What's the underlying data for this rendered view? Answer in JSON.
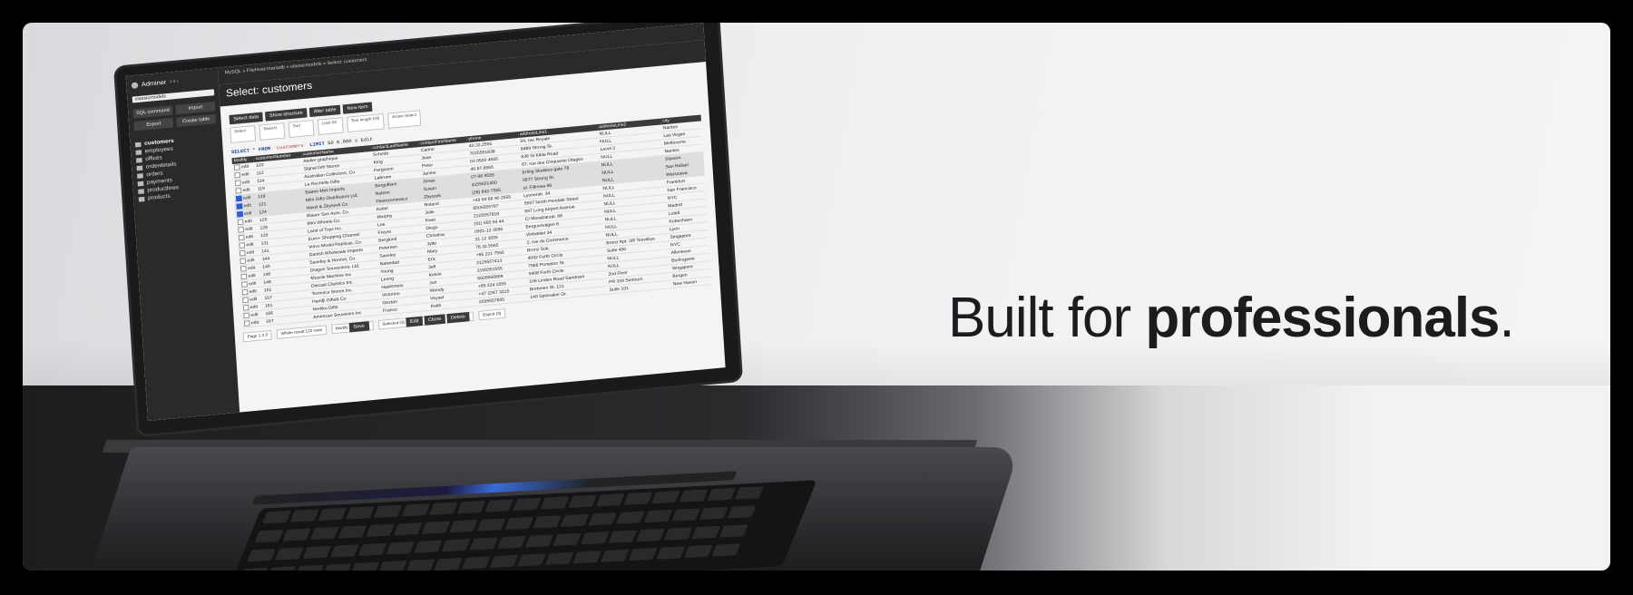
{
  "headline": {
    "light": "Built for ",
    "bold": "professionals",
    "dot": "."
  },
  "app": {
    "name": "Adminer",
    "version": "4.8.1",
    "database": "classicmodels",
    "breadcrumb": "MySQL » FileHost-mariadb » classicmodels » Select: customers",
    "page_title": "Select: customers",
    "side_buttons": [
      "SQL command",
      "Import",
      "Export",
      "Create table"
    ],
    "tables": [
      "customers",
      "employees",
      "offices",
      "orderdetails",
      "orders",
      "payments",
      "productlines",
      "products"
    ],
    "action_buttons": [
      "Select data",
      "Show structure",
      "Alter table",
      "New item"
    ],
    "options": [
      {
        "label": "Select",
        "value": ""
      },
      {
        "label": "Search",
        "value": ""
      },
      {
        "label": "Sort",
        "value": ""
      },
      {
        "label": "Limit",
        "value": "50"
      },
      {
        "label": "Text length",
        "value": "100"
      },
      {
        "label": "Action",
        "value": "Select"
      }
    ],
    "query": {
      "select": "SELECT",
      "star": "*",
      "from": "FROM",
      "table": "`customers`",
      "limit": "LIMIT",
      "n": "50",
      "tail": "0.000 s Edit"
    },
    "columns": [
      "Modify",
      "customerNumber",
      "customerName",
      "contactLastName",
      "contactFirstName",
      "phone",
      "addressLine1",
      "addressLine2",
      "city"
    ],
    "rows": [
      {
        "checked": false,
        "edit": "edit",
        "num": "103",
        "name": "Atelier graphique",
        "last": "Schmitt",
        "first": "Carine",
        "phone": "40.32.2555",
        "addr1": "54, rue Royale",
        "addr2": "NULL",
        "city": "Nantes"
      },
      {
        "checked": false,
        "edit": "edit",
        "num": "112",
        "name": "Signal Gift Stores",
        "last": "King",
        "first": "Jean",
        "phone": "7025551838",
        "addr1": "8489 Strong St.",
        "addr2": "NULL",
        "city": "Las Vegas"
      },
      {
        "checked": false,
        "edit": "edit",
        "num": "114",
        "name": "Australian Collectors, Co.",
        "last": "Ferguson",
        "first": "Peter",
        "phone": "03 9520 4555",
        "addr1": "636 St Kilda Road",
        "addr2": "Level 3",
        "city": "Melbourne"
      },
      {
        "checked": false,
        "edit": "edit",
        "num": "119",
        "name": "La Rochelle Gifts",
        "last": "Labrune",
        "first": "Janine",
        "phone": "40.67.8555",
        "addr1": "67, rue des Cinquante Otages",
        "addr2": "NULL",
        "city": "Nantes"
      },
      {
        "checked": true,
        "edit": "edit",
        "num": "119",
        "name": "Baane Mini Imports",
        "last": "Bergulfsen",
        "first": "Jonas",
        "phone": "07-98 9555",
        "addr1": "Erling Skakkes gate 78",
        "addr2": "NULL",
        "city": "Stavern"
      },
      {
        "checked": true,
        "edit": "edit",
        "num": "121",
        "name": "Mini Gifts Distributors Ltd.",
        "last": "Nelson",
        "first": "Susan",
        "phone": "4155551450",
        "addr1": "5677 Strong St.",
        "addr2": "NULL",
        "city": "San Rafael"
      },
      {
        "checked": true,
        "edit": "edit",
        "num": "124",
        "name": "Havel & Zbyszek Co",
        "last": "Piestrzeniewicz",
        "first": "Zbyszek",
        "phone": "(26) 642-7555",
        "addr1": "ul. Filtrowa 68",
        "addr2": "NULL",
        "city": "Warszawa"
      },
      {
        "checked": false,
        "edit": "edit",
        "num": "125",
        "name": "Blauer See Auto, Co.",
        "last": "Keitel",
        "first": "Roland",
        "phone": "+49 69 66 90 2555",
        "addr1": "Lyonerstr. 34",
        "addr2": "NULL",
        "city": "Frankfurt"
      },
      {
        "checked": false,
        "edit": "edit",
        "num": "128",
        "name": "Mini Wheels Co.",
        "last": "Murphy",
        "first": "Julie",
        "phone": "6505555787",
        "addr1": "5557 North Pendale Street",
        "addr2": "NULL",
        "city": "San Francisco"
      },
      {
        "checked": false,
        "edit": "edit",
        "num": "129",
        "name": "Land of Toys Inc.",
        "last": "Lee",
        "first": "Kwai",
        "phone": "2125557818",
        "addr1": "897 Long Airport Avenue",
        "addr2": "NULL",
        "city": "NYC"
      },
      {
        "checked": false,
        "edit": "edit",
        "num": "131",
        "name": "Euro+ Shopping Channel",
        "last": "Freyre",
        "first": "Diego",
        "phone": "(91) 555 94 44",
        "addr1": "C/ Moralzarzal, 86",
        "addr2": "NULL",
        "city": "Madrid"
      },
      {
        "checked": false,
        "edit": "edit",
        "num": "141",
        "name": "Volvo Model Replicas, Co",
        "last": "Berglund",
        "first": "Christina",
        "phone": "0921-12 3555",
        "addr1": "Berguvsvägen 8",
        "addr2": "NULL",
        "city": "Luleå"
      },
      {
        "checked": false,
        "edit": "edit",
        "num": "144",
        "name": "Danish Wholesale Imports",
        "last": "Petersen",
        "first": "Jytte",
        "phone": "31 12 3555",
        "addr1": "Vinbæltet 34",
        "addr2": "NULL",
        "city": "Kobenhavn"
      },
      {
        "checked": false,
        "edit": "edit",
        "num": "145",
        "name": "Saveley & Henriot, Co.",
        "last": "Saveley",
        "first": "Mary",
        "phone": "78.32.5555",
        "addr1": "2, rue du Commerce",
        "addr2": "NULL",
        "city": "Lyon"
      },
      {
        "checked": false,
        "edit": "edit",
        "num": "146",
        "name": "Dragon Souveniers, Ltd.",
        "last": "Natividad",
        "first": "Eric",
        "phone": "+65 221 7555",
        "addr1": "Bronz Sok.",
        "addr2": "Bronz Apt. 3/6 Tesvikiye",
        "city": "Singapore"
      },
      {
        "checked": false,
        "edit": "edit",
        "num": "148",
        "name": "Muscle Machine Inc",
        "last": "Young",
        "first": "Jeff",
        "phone": "2125557413",
        "addr1": "4092 Furth Circle",
        "addr2": "Suite 400",
        "city": "NYC"
      },
      {
        "checked": false,
        "edit": "edit",
        "num": "151",
        "name": "Diecast Classics Inc.",
        "last": "Leong",
        "first": "Kelvin",
        "phone": "2155551555",
        "addr1": "7586 Pompton St.",
        "addr2": "NULL",
        "city": "Allentown"
      },
      {
        "checked": false,
        "edit": "edit",
        "num": "157",
        "name": "Technics Stores Inc.",
        "last": "Hashimoto",
        "first": "Juri",
        "phone": "6505556809",
        "addr1": "9408 Furth Circle",
        "addr2": "NULL",
        "city": "Burlingame"
      },
      {
        "checked": false,
        "edit": "edit",
        "num": "161",
        "name": "Handji Gifts& Co",
        "last": "Victorino",
        "first": "Wendy",
        "phone": "+65 224 1555",
        "addr1": "106 Linden Road Sandown",
        "addr2": "2nd Floor",
        "city": "Singapore"
      },
      {
        "checked": false,
        "edit": "edit",
        "num": "166",
        "name": "Herkku Gifts",
        "last": "Oeztan",
        "first": "Veysel",
        "phone": "+47 2267 3215",
        "addr1": "Brehmen St. 121",
        "addr2": "PR 334 Sentrum",
        "city": "Bergen"
      },
      {
        "checked": false,
        "edit": "edit",
        "num": "167",
        "name": "American Souvenirs Inc",
        "last": "Franco",
        "first": "Keith",
        "phone": "2035557845",
        "addr1": "149 Spinnaker Dr.",
        "addr2": "Suite 101",
        "city": "New Haven"
      }
    ],
    "footer": {
      "page_label": "Page",
      "page_value": "1 2 3",
      "whole_label": "Whole result",
      "whole_value": "122 rows",
      "modify_label": "Modify",
      "modify_btn": "Save",
      "selected_label": "Selected (3)",
      "sel_btns": [
        "Edit",
        "Clone",
        "Delete"
      ],
      "export_label": "Export (3)"
    }
  }
}
